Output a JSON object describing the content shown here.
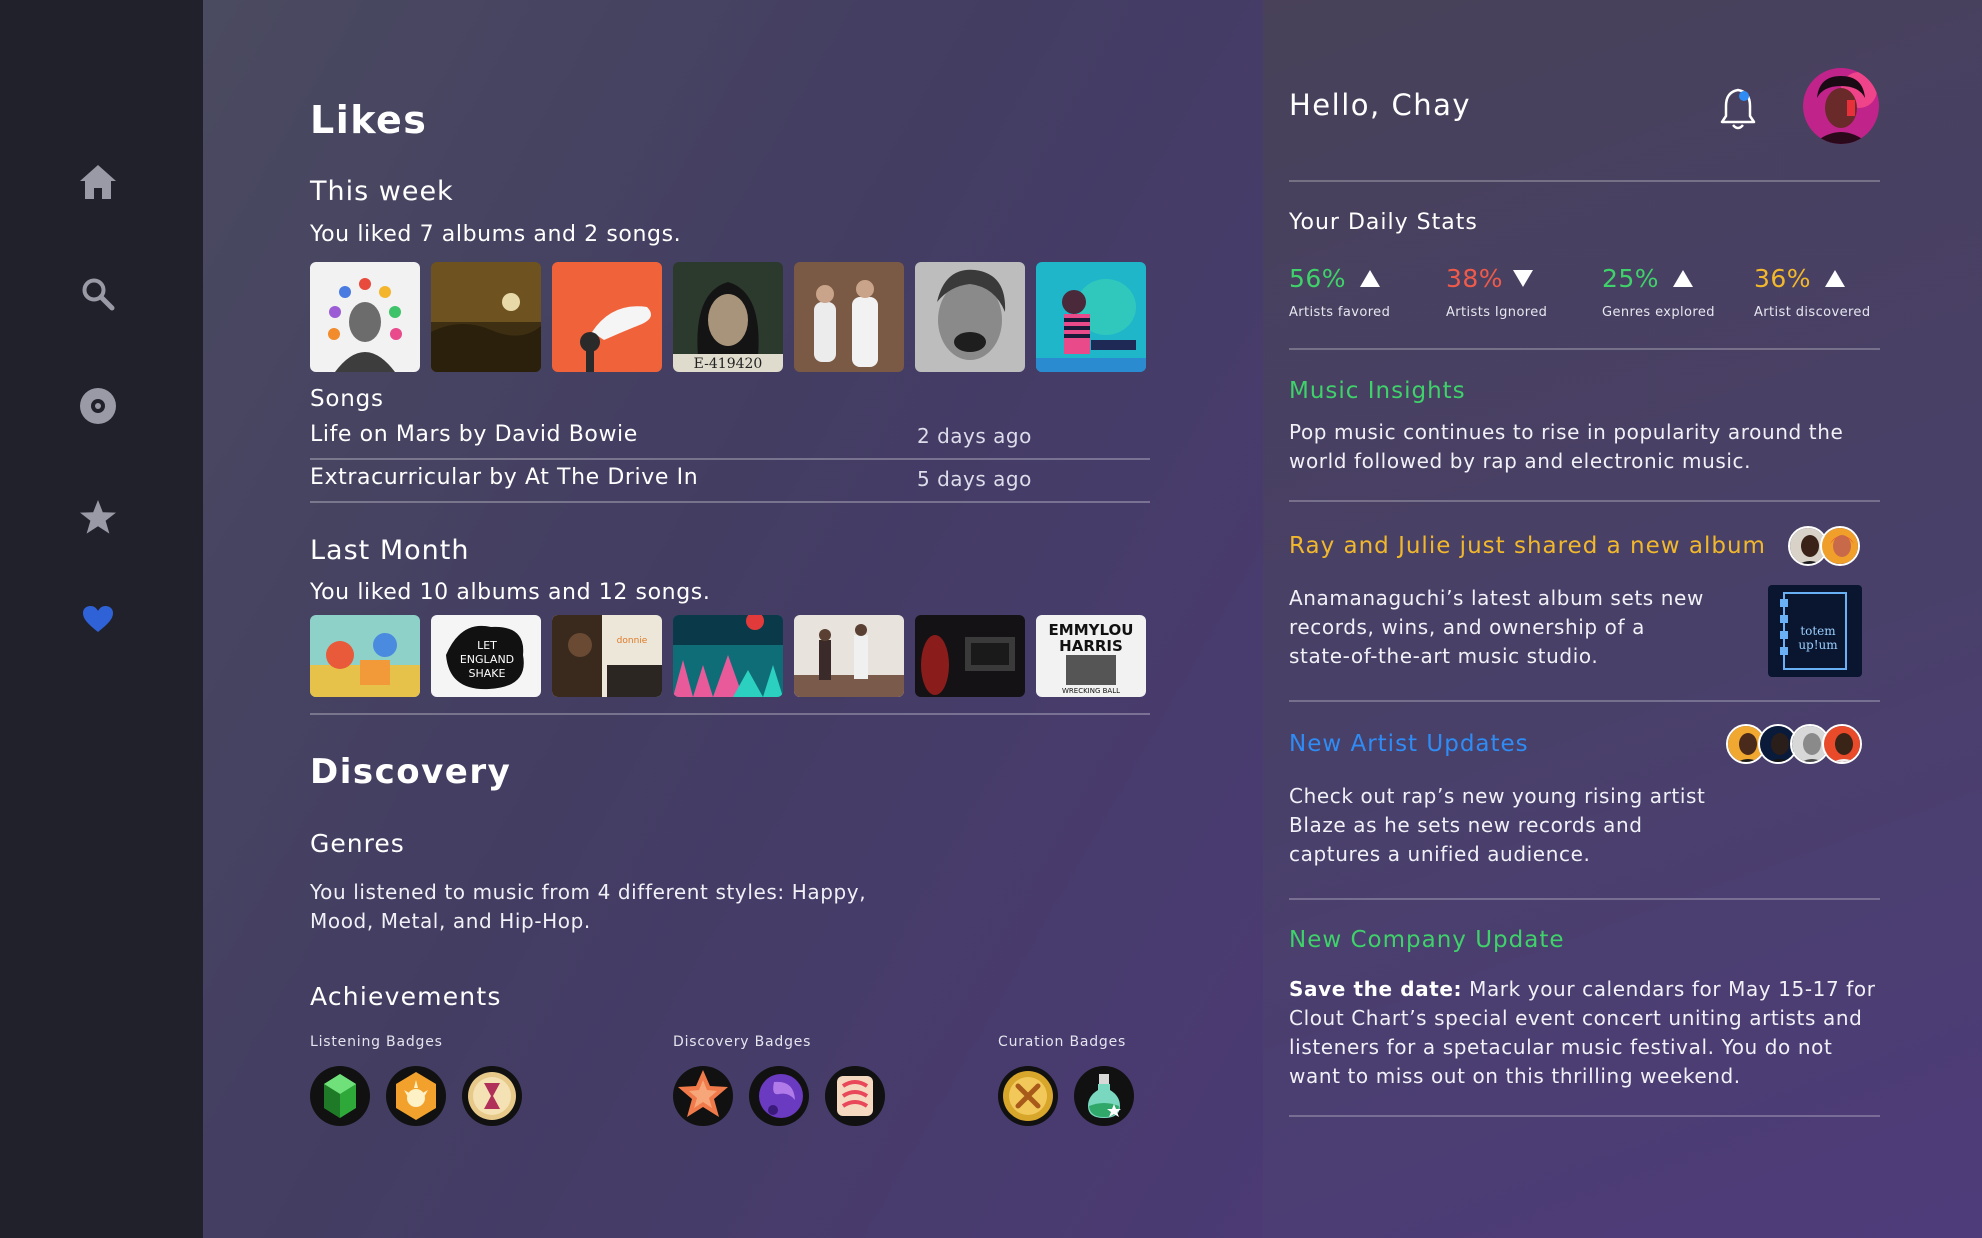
{
  "sidebar": {
    "items": [
      {
        "icon": "home-icon"
      },
      {
        "icon": "search-icon"
      },
      {
        "icon": "disc-icon"
      },
      {
        "icon": "star-icon"
      },
      {
        "icon": "heart-icon",
        "active_color": "#2f62d6"
      }
    ]
  },
  "likes": {
    "title": "Likes",
    "this_week": {
      "heading": "This week",
      "summary": "You liked 7 albums and 2 songs.",
      "songs_heading": "Songs",
      "songs": [
        {
          "title": "Life on Mars by David Bowie",
          "time": "2 days ago"
        },
        {
          "title": "Extracurricular by At The Drive In",
          "time": "5 days ago"
        }
      ]
    },
    "last_month": {
      "heading": "Last Month",
      "summary": "You liked 10 albums and 12 songs."
    }
  },
  "discovery": {
    "title": "Discovery",
    "genres_heading": "Genres",
    "genres_text": "You listened to music from 4 different styles: Happy, Mood, Metal, and Hip-Hop.",
    "achievements_heading": "Achievements",
    "badge_groups": [
      {
        "label": "Listening Badges"
      },
      {
        "label": "Discovery  Badges"
      },
      {
        "label": "Curation  Badges"
      }
    ]
  },
  "panel": {
    "greeting": "Hello, Chay",
    "daily_stats_heading": "Your Daily Stats",
    "stats": [
      {
        "value": "56%",
        "label": "Artists favored",
        "color": "#3fd16a",
        "trend": "up"
      },
      {
        "value": "38%",
        "label": "Artists Ignored",
        "color": "#ef5a4a",
        "trend": "down"
      },
      {
        "value": "25%",
        "label": "Genres explored",
        "color": "#3fd16a",
        "trend": "up"
      },
      {
        "value": "36%",
        "label": "Artist discovered",
        "color": "#f2b82c",
        "trend": "up"
      }
    ],
    "insights": {
      "title": "Music Insights",
      "color": "#3fd16a",
      "text": "Pop music continues to rise in popularity around the world followed by rap and electronic music."
    },
    "shared": {
      "title": "Ray and Julie just shared a new album",
      "color": "#f2b82c",
      "text": "Anamanaguchi’s latest album sets new records, wins, and ownership of a state-of-the-art music studio."
    },
    "artist_updates": {
      "title": "New Artist Updates",
      "color": "#2f8cf5",
      "text": "Check out rap’s new young rising artist Blaze as he sets new records and captures a unified audience."
    },
    "company": {
      "title": "New Company Update",
      "color": "#3fd16a",
      "lead": "Save the date:",
      "text": " Mark your calendars for May 15-17 for Clout Chart’s special event concert uniting artists and listeners for a spetacular music festival. You do not want to miss out on this thrilling weekend."
    }
  }
}
